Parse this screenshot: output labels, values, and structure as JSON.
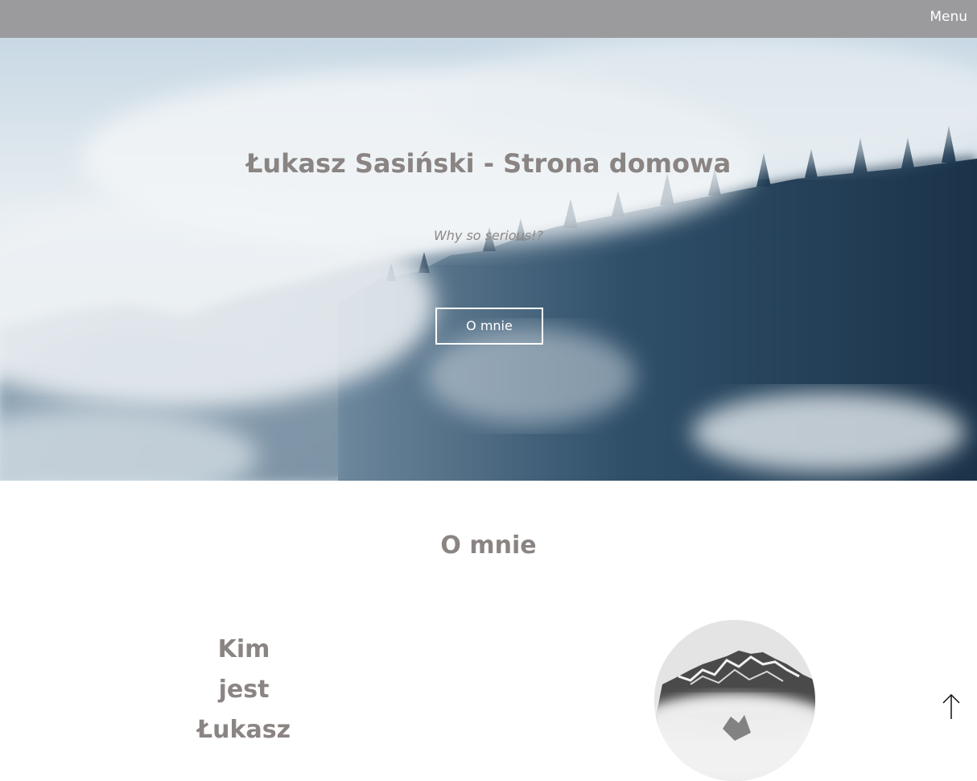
{
  "navbar": {
    "menu_label": "Menu"
  },
  "hero": {
    "title": "Łukasz Sasiński - Strona domowa",
    "subtitle": "Why so serious!?",
    "button_label": "O mnie"
  },
  "about": {
    "heading": "O mnie",
    "question_lines": [
      "Kim",
      "jest",
      "Łukasz"
    ]
  },
  "icons": {
    "back_to_top": "arrow-up-icon"
  },
  "colors": {
    "navbar": "#9b9b9e",
    "heading_text": "#8a8482",
    "button_border": "#ffffff",
    "forest_dark": "#1e3a52"
  }
}
